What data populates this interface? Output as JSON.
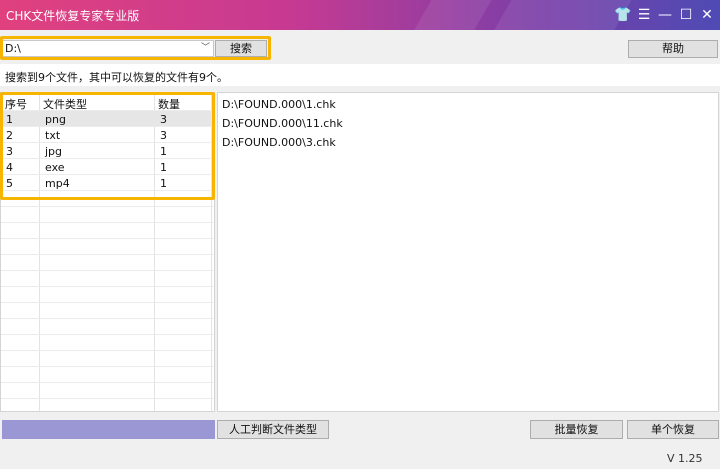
{
  "window": {
    "title": "CHK文件恢复专家专业版",
    "controls": [
      "👕",
      "☰",
      "—",
      "☐",
      "✕"
    ]
  },
  "toolbar": {
    "drive_value": "D:\\",
    "search_label": "搜索",
    "help_label": "帮助"
  },
  "status": "搜索到9个文件，其中可以恢复的文件有9个。",
  "table": {
    "headers": [
      "序号",
      "文件类型",
      "数量"
    ],
    "rows": [
      {
        "index": "1",
        "type": "png",
        "count": "3"
      },
      {
        "index": "2",
        "type": "txt",
        "count": "3"
      },
      {
        "index": "3",
        "type": "jpg",
        "count": "1"
      },
      {
        "index": "4",
        "type": "exe",
        "count": "1"
      },
      {
        "index": "5",
        "type": "mp4",
        "count": "1"
      }
    ]
  },
  "files": [
    "D:\\FOUND.000\\1.chk",
    "D:\\FOUND.000\\11.chk",
    "D:\\FOUND.000\\3.chk"
  ],
  "buttons": {
    "manual": "人工判断文件类型",
    "batch": "批量恢复",
    "single": "单个恢复"
  },
  "version": "V 1.25",
  "colors": {
    "highlight": "#f7b500",
    "progress": "#9b97d4",
    "title_start": "#e0417e",
    "title_end": "#4f4bb4"
  }
}
